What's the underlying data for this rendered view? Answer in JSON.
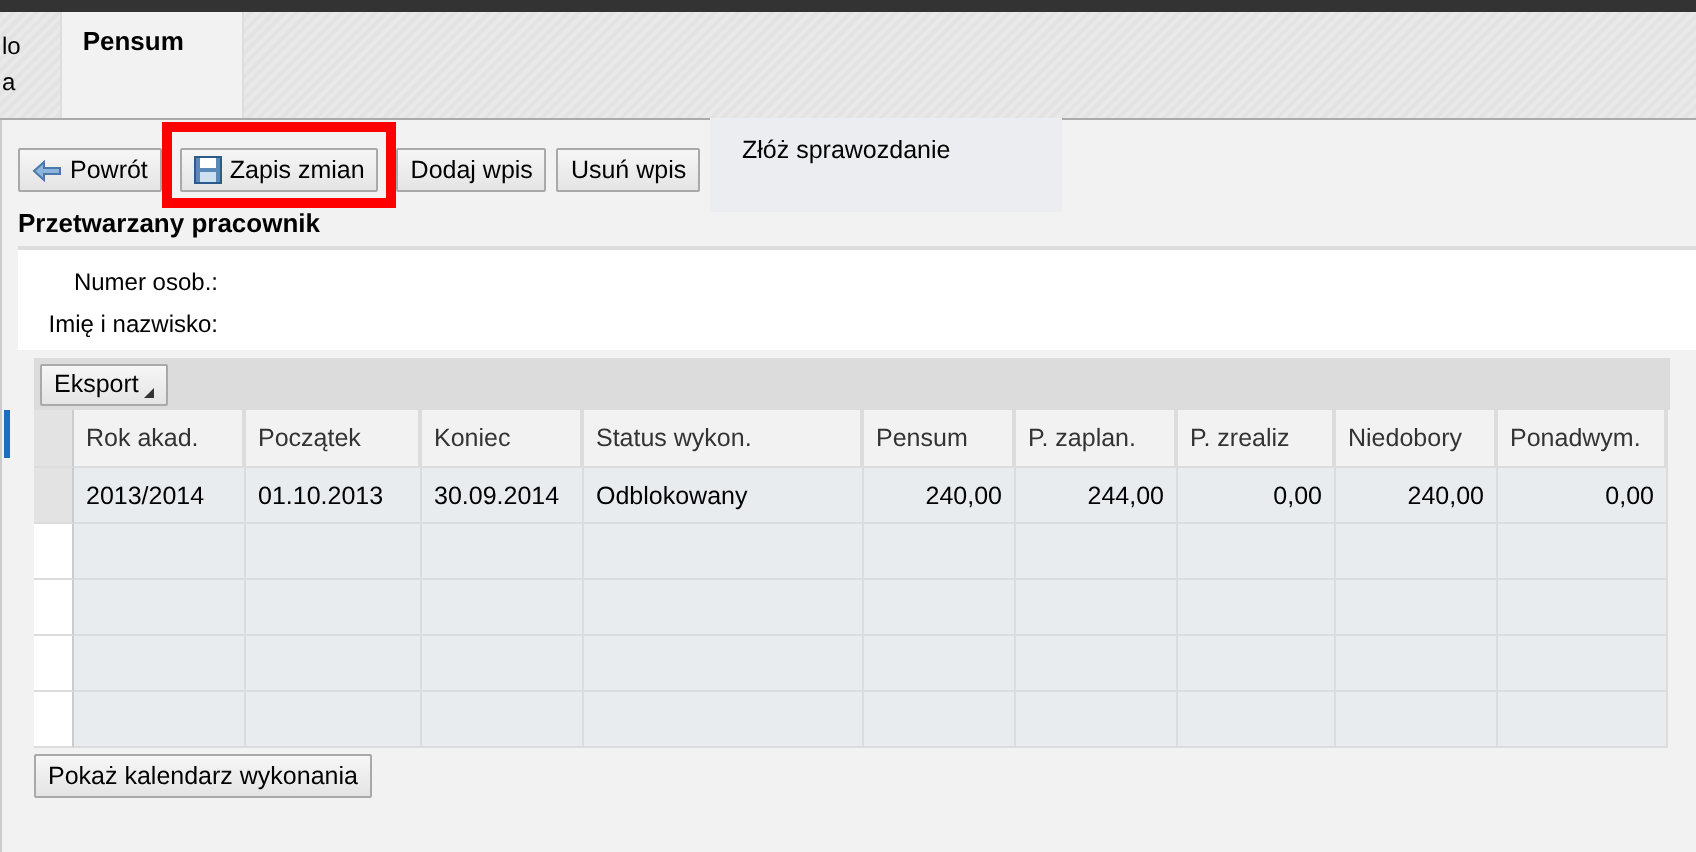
{
  "tabs": [
    {
      "label": "lo\na",
      "selected": false
    },
    {
      "label": "Pensum",
      "selected": true
    }
  ],
  "toolbar": {
    "buttons": [
      {
        "label": "Powrót",
        "highlighted": false
      },
      {
        "label": "Zapis zmian",
        "highlighted": true
      },
      {
        "label": "Dodaj wpis",
        "highlighted": false
      },
      {
        "label": "Usuń wpis",
        "highlighted": false
      }
    ],
    "menu": {
      "items": [
        "Złóż sprawozdanie"
      ]
    }
  },
  "employee": {
    "title": "Przetwarzany pracownik",
    "fields": [
      {
        "label": "Numer osob.:"
      },
      {
        "label": "Imię i nazwisko:"
      }
    ]
  },
  "table": {
    "export_button": "Eksport",
    "columns": [
      "Rok akad.",
      "Początek",
      "Koniec",
      "Status wykon.",
      "Pensum",
      "P. zaplan.",
      "P. zrealiz",
      "Niedobory",
      "Ponadwym."
    ],
    "rows": [
      [
        "2013/2014",
        "01.10.2013",
        "30.09.2014",
        "Odblokowany",
        "240,00",
        "244,00",
        "0,00",
        "240,00",
        "0,00"
      ]
    ]
  },
  "footer_button": "Pokaż kalendarz wykonania"
}
